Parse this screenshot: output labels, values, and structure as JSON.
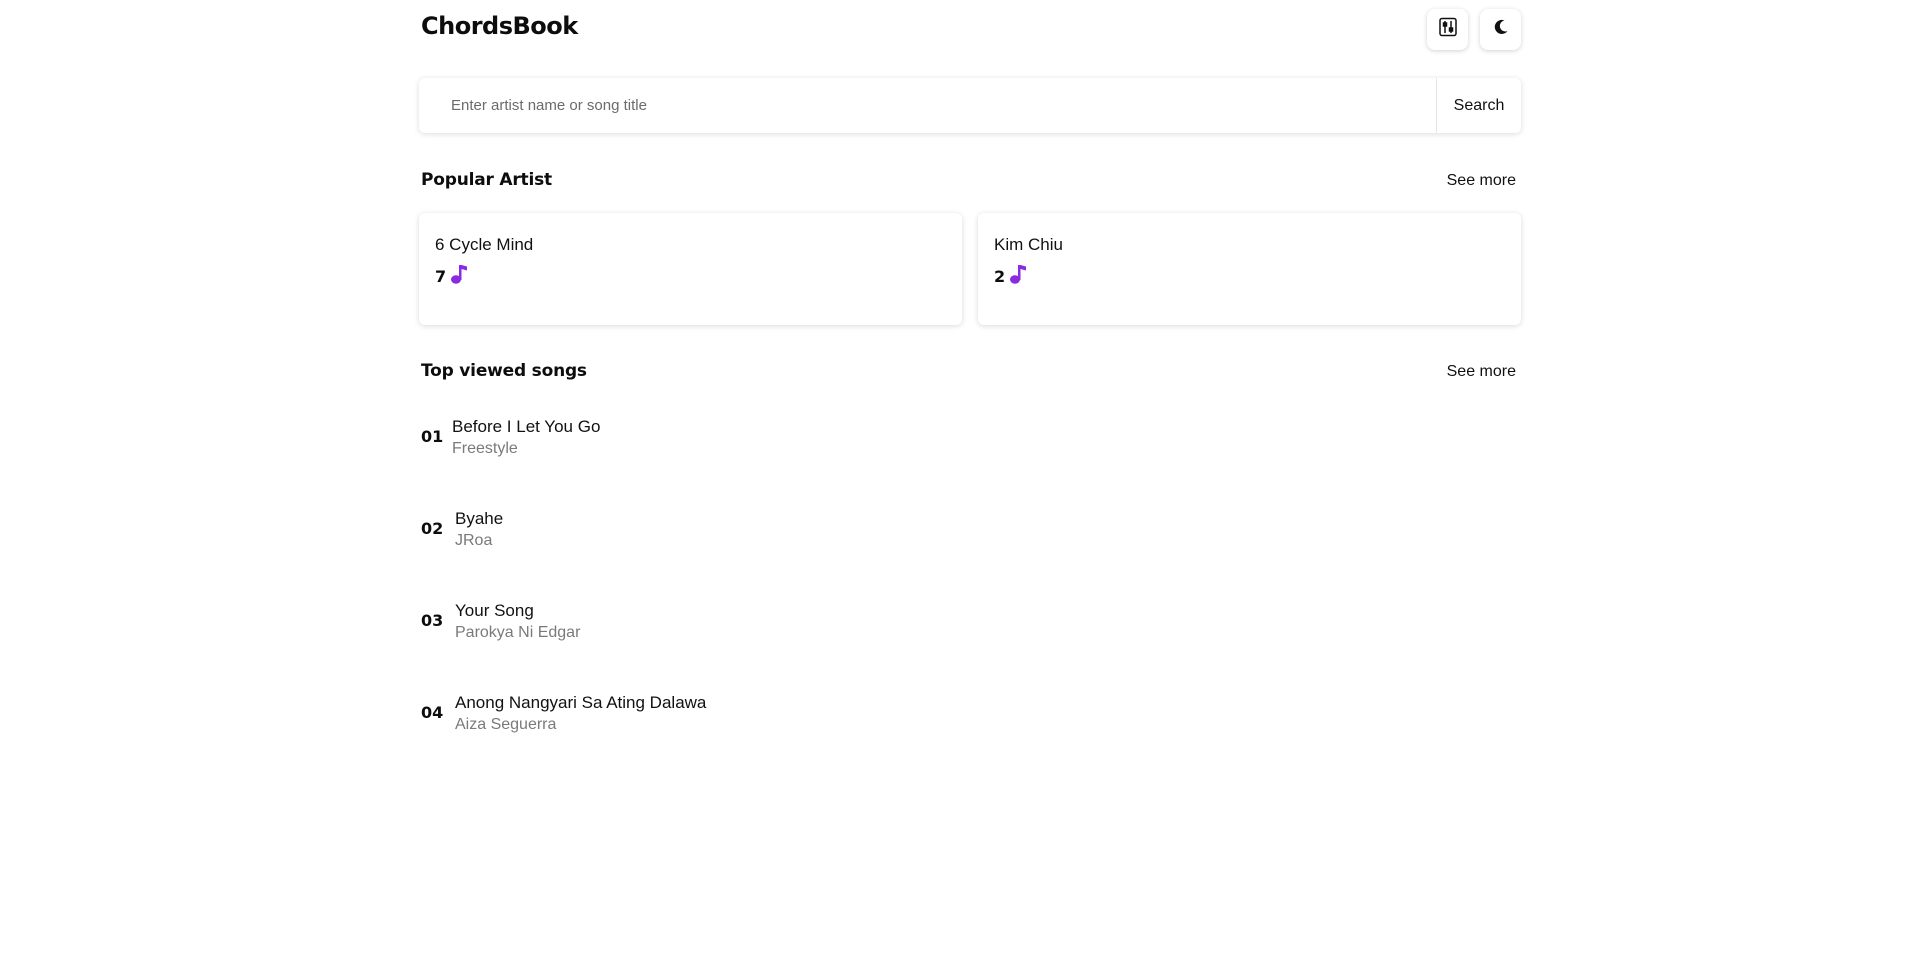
{
  "app": {
    "title": "ChordsBook"
  },
  "header": {
    "icons": [
      "sliders-icon",
      "moon-icon"
    ]
  },
  "search": {
    "placeholder": "Enter artist name or song title",
    "value": "",
    "button_label": "Search"
  },
  "popular_artist": {
    "title": "Popular Artist",
    "see_more": "See more",
    "items": [
      {
        "name": "6 Cycle Mind",
        "song_count": "7"
      },
      {
        "name": "Kim Chiu",
        "song_count": "2"
      }
    ]
  },
  "top_songs": {
    "title": "Top viewed songs",
    "see_more": "See more",
    "items": [
      {
        "rank": "01",
        "title": "Before I Let You Go",
        "artist": "Freestyle"
      },
      {
        "rank": "02",
        "title": "Byahe",
        "artist": "JRoa"
      },
      {
        "rank": "03",
        "title": "Your Song",
        "artist": "Parokya Ni Edgar"
      },
      {
        "rank": "04",
        "title": "Anong Nangyari Sa Ating Dalawa",
        "artist": "Aiza Seguerra"
      }
    ]
  },
  "colors": {
    "accent": "#8a2be2",
    "text": "#111111",
    "muted": "#7a7a7a"
  }
}
